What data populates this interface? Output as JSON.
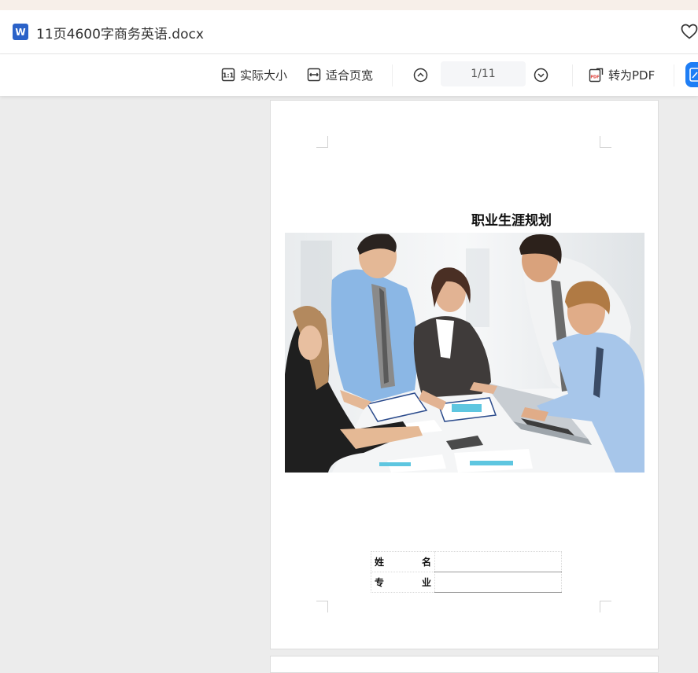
{
  "app": {
    "file_icon": "W",
    "filename": "11页4600字商务英语.docx"
  },
  "toolbar": {
    "actual_size": "实际大小",
    "fit_width": "适合页宽",
    "page_indicator": "1/11",
    "to_pdf": "转为PDF"
  },
  "document": {
    "title": "职业生涯规划",
    "table": [
      {
        "label_left": "姓",
        "label_right": "名",
        "value": ""
      },
      {
        "label_left": "专",
        "label_right": "业",
        "value": ""
      }
    ]
  },
  "colors": {
    "word_blue": "#2b62c8",
    "accent_blue": "#1f7ef5",
    "viewer_bg": "#ececec"
  }
}
